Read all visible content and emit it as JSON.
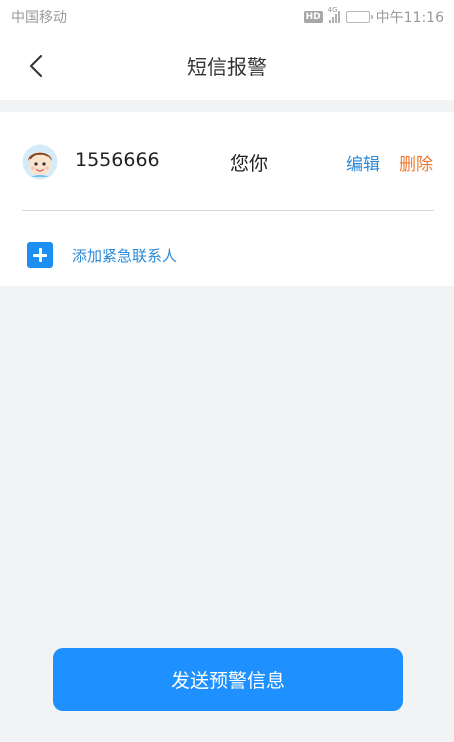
{
  "status_bar": {
    "carrier": "中国移动",
    "hd_badge": "HD",
    "network": "4G",
    "time": "中午11:16",
    "battery_level": 0.2
  },
  "nav": {
    "title": "短信报警",
    "back_icon": "chevron-left-icon"
  },
  "contacts": [
    {
      "phone": "1556666",
      "name": "您你",
      "edit_label": "编辑",
      "delete_label": "删除"
    }
  ],
  "add_contact": {
    "label": "添加紧急联系人",
    "icon": "plus-square-icon"
  },
  "send_button": {
    "label": "发送预警信息"
  },
  "colors": {
    "primary": "#1e90ff",
    "link": "#2a8ad8",
    "danger": "#ef7a2e",
    "background": "#f2f3f5"
  }
}
